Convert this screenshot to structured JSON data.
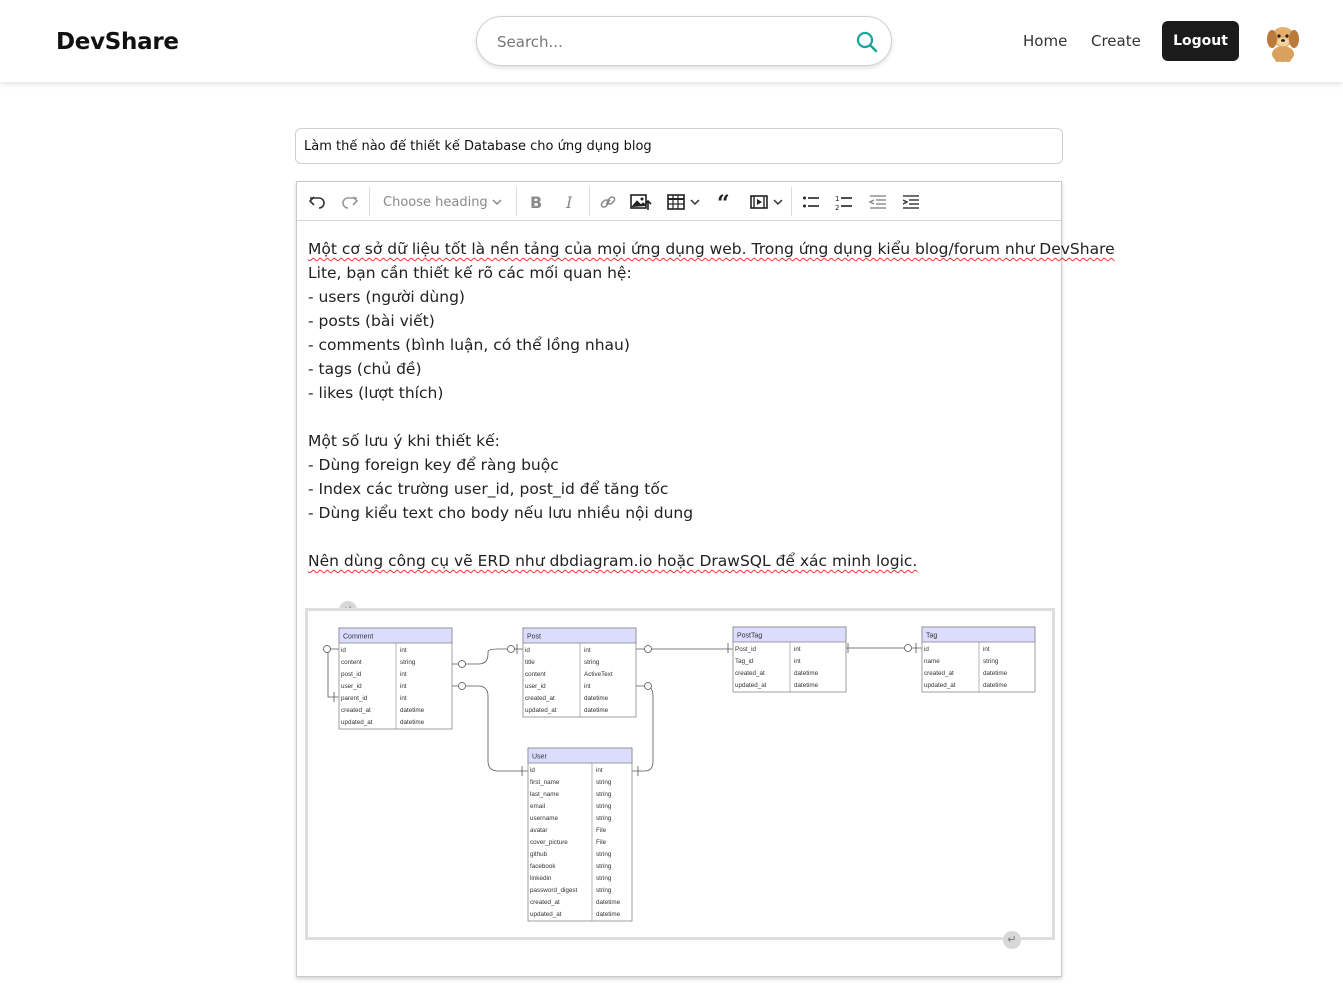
{
  "header": {
    "brand": "DevShare",
    "search_placeholder": "Search...",
    "nav_home": "Home",
    "nav_create": "Create",
    "logout_label": "Logout"
  },
  "post": {
    "title": "Làm thế nào để thiết kế Database cho ứng dụng blog"
  },
  "toolbar": {
    "heading_placeholder": "Choose heading"
  },
  "body": {
    "l1": "Một cơ sở dữ liệu tốt là nền tảng của mọi ứng dụng web. Trong ứng dụng kiểu blog/forum như DevShare",
    "l2": "Lite, bạn cần thiết kế rõ các mối quan hệ:",
    "l3": "- users (người dùng)",
    "l4": "- posts (bài viết)",
    "l5": "- comments (bình luận, có thể lồng nhau)",
    "l6": "- tags (chủ đề)",
    "l7": "- likes (lượt thích)",
    "l9": "Một số lưu ý khi thiết kế:",
    "l10": "- Dùng foreign key để ràng buộc",
    "l11": "- Index các trường user_id, post_id để tăng tốc",
    "l12": "- Dùng kiểu text cho body nếu lưu nhiều nội dung",
    "l14": "Nên dùng công cụ vẽ ERD như dbdiagram.io hoặc DrawSQL để xác minh logic."
  },
  "erd": {
    "comment": {
      "name": "Comment",
      "rows": [
        [
          "id",
          "int"
        ],
        [
          "content",
          "string"
        ],
        [
          "post_id",
          "int"
        ],
        [
          "user_id",
          "int"
        ],
        [
          "parent_id",
          "int"
        ],
        [
          "created_at",
          "datetime"
        ],
        [
          "updated_at",
          "datetime"
        ]
      ]
    },
    "post": {
      "name": "Post",
      "rows": [
        [
          "id",
          "int"
        ],
        [
          "title",
          "string"
        ],
        [
          "content",
          "ActiveText"
        ],
        [
          "user_id",
          "int"
        ],
        [
          "created_at",
          "datetime"
        ],
        [
          "updated_at",
          "datetime"
        ]
      ]
    },
    "posttag": {
      "name": "PostTag",
      "rows": [
        [
          "Post_id",
          "int"
        ],
        [
          "Tag_id",
          "int"
        ],
        [
          "created_at",
          "datetime"
        ],
        [
          "updated_at",
          "datetime"
        ]
      ]
    },
    "tag": {
      "name": "Tag",
      "rows": [
        [
          "id",
          "int"
        ],
        [
          "name",
          "string"
        ],
        [
          "created_at",
          "datetime"
        ],
        [
          "updated_at",
          "datetime"
        ]
      ]
    },
    "user": {
      "name": "User",
      "rows": [
        [
          "id",
          "int"
        ],
        [
          "first_name",
          "string"
        ],
        [
          "last_name",
          "string"
        ],
        [
          "email",
          "string"
        ],
        [
          "username",
          "string"
        ],
        [
          "avatar",
          "File"
        ],
        [
          "cover_picture",
          "File"
        ],
        [
          "github",
          "string"
        ],
        [
          "facebook",
          "string"
        ],
        [
          "linkedin",
          "string"
        ],
        [
          "password_digest",
          "string"
        ],
        [
          "created_at",
          "datetime"
        ],
        [
          "updated_at",
          "datetime"
        ]
      ]
    }
  },
  "colors": {
    "logout_bg": "#1b1b1b",
    "search_icon": "#14a59c",
    "spell_underline": "#e53935",
    "erd_header": "#dcdcff"
  }
}
